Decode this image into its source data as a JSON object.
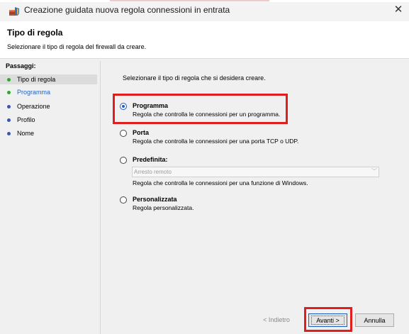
{
  "window": {
    "title": "Creazione guidata nuova regola connessioni in entrata",
    "app_icon": "firewall-shield-icon",
    "close_icon": "close-icon"
  },
  "header": {
    "title": "Tipo di regola",
    "subtitle": "Selezionare il tipo di regola del firewall da creare."
  },
  "steps": {
    "label": "Passaggi:",
    "items": [
      {
        "label": "Tipo di regola",
        "state": "current"
      },
      {
        "label": "Programma",
        "state": "next"
      },
      {
        "label": "Operazione",
        "state": "pending"
      },
      {
        "label": "Profilo",
        "state": "pending"
      },
      {
        "label": "Nome",
        "state": "pending"
      }
    ]
  },
  "main": {
    "instruction": "Selezionare il tipo di regola che si desidera creare.",
    "options": [
      {
        "title": "Programma",
        "description": "Regola che controlla le connessioni per un programma.",
        "checked": true
      },
      {
        "title": "Porta",
        "description": "Regola che controlla le connessioni per una porta TCP o UDP.",
        "checked": false
      },
      {
        "title": "Predefinita:",
        "description": "Regola che controlla le connessioni per una funzione di Windows.",
        "checked": false,
        "select_value": "Arresto remoto"
      },
      {
        "title": "Personalizzata",
        "description": "Regola personalizzata.",
        "checked": false
      }
    ]
  },
  "buttons": {
    "back": "< Indietro",
    "next": "Avanti >",
    "cancel": "Annulla"
  },
  "colors": {
    "highlight": "#e01e1e",
    "accent": "#1a5fc2",
    "step_done": "#31a531",
    "step_pending": "#3e54b3"
  }
}
